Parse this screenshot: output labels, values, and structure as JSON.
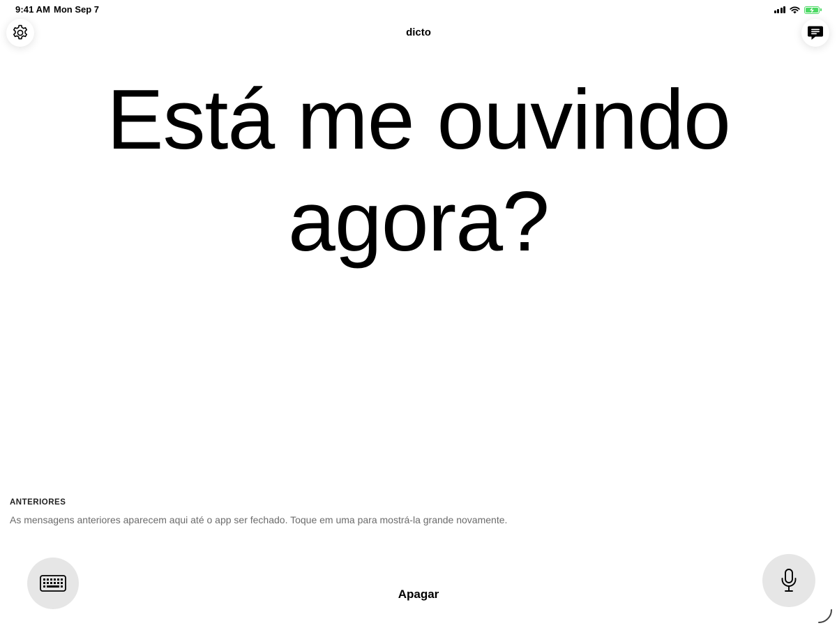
{
  "status_bar": {
    "time": "9:41 AM",
    "date": "Mon Sep 7",
    "battery_color": "#4cd964"
  },
  "header": {
    "title": "dicto",
    "settings_icon": "gear-icon",
    "messages_icon": "chat-bubble-icon"
  },
  "main": {
    "message_line1": "Está me ouvindo",
    "message_line2": "agora?"
  },
  "previous": {
    "heading": "ANTERIORES",
    "hint": "As mensagens anteriores aparecem aqui até o app ser fechado. Toque em uma para mostrá-la grande novamente."
  },
  "controls": {
    "keyboard_icon": "keyboard-icon",
    "clear_label": "Apagar",
    "mic_icon": "microphone-icon"
  },
  "colors": {
    "background": "#ffffff",
    "button_gray": "#e6e6e6",
    "hint_text": "#6b6b6b"
  }
}
